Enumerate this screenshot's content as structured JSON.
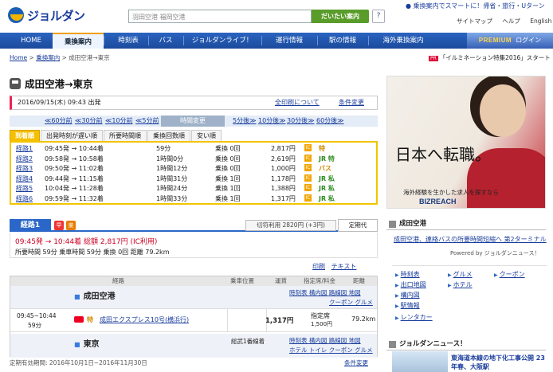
{
  "header": {
    "logo_text": "ジョルダン",
    "search_placeholder": "羽田空港 福岡空港",
    "search_button": "だいたい案内",
    "help_icon": "?",
    "promo": "● 乗換案内でスマートに！帰省・旅行・Uターン",
    "top_links": [
      "サイトマップ",
      "ヘルプ",
      "English"
    ]
  },
  "nav": {
    "items": [
      "HOME",
      "乗換案内",
      "時刻表",
      "バス",
      "ジョルダンライブ！",
      "運行情報",
      "駅の情報",
      "海外乗換案内"
    ],
    "active": "乗換案内",
    "premium": "PREMIUM",
    "login": "ログイン"
  },
  "breadcrumb": [
    "Home",
    "乗換案内",
    "成田空港→東京"
  ],
  "pr": {
    "tag": "PR",
    "text": "「イルミネーション特集2016」スタート"
  },
  "title": "成田空港→東京",
  "datetime": "2016/09/15(木) 09:43 出発",
  "link_all": "全印刷について",
  "link_change": "条件変更",
  "prev_links": [
    "≪60分前",
    "≪30分前",
    "≪10分前",
    "≪5分前"
  ],
  "time_change": "時間変更",
  "next_links": [
    "5分後≫",
    "10分後≫",
    "30分後≫",
    "60分後≫"
  ],
  "sort_tabs": [
    "到着順",
    "出発時刻が遅い順",
    "所要時間順",
    "乗換回数順",
    "安い順"
  ],
  "routes": [
    {
      "name": "経路1",
      "time": "09:45発 → 10:44着",
      "dur": "59分",
      "xfer": "乗換 0回",
      "fare": "2,817円",
      "kind": "特",
      "kc": "o"
    },
    {
      "name": "経路2",
      "time": "09:58発 → 10:58着",
      "dur": "1時間0分",
      "xfer": "乗換 0回",
      "fare": "2,619円",
      "kind": "JR 特",
      "kc": "g"
    },
    {
      "name": "経路3",
      "time": "09:50発 → 11:02着",
      "dur": "1時間12分",
      "xfer": "乗換 0回",
      "fare": "1,000円",
      "kind": "バス",
      "kc": "o"
    },
    {
      "name": "経路4",
      "time": "09:44発 → 11:15着",
      "dur": "1時間31分",
      "xfer": "乗換 1回",
      "fare": "1,178円",
      "kind": "JR 私",
      "kc": "g"
    },
    {
      "name": "経路5",
      "time": "10:04発 → 11:28着",
      "dur": "1時間24分",
      "xfer": "乗換 1回",
      "fare": "1,388円",
      "kind": "JR 私",
      "kc": "g"
    },
    {
      "name": "経路6",
      "time": "09:59発 → 11:32着",
      "dur": "1時間33分",
      "xfer": "乗換 1回",
      "fare": "1,317円",
      "kind": "JR 私",
      "kc": "g"
    }
  ],
  "route_detail": {
    "tab": "経路1",
    "badges": [
      "早",
      "楽"
    ],
    "kirifu": "切符利用 2820円 (+3円)",
    "teiki": "定期代",
    "line1": "09:45発 → 10:44着  総額 2,817円 (IC利用)",
    "line2": "所要時間 59分  乗車時間 59分  乗換 0回  距離 79.2km",
    "print": "印刷",
    "text": "テキスト",
    "headers": [
      "経路",
      "乗車位置",
      "運賃",
      "指定席/料金",
      "距離"
    ],
    "start_station": "成田空港",
    "start_links": [
      "時刻表",
      "構内図",
      "路線図",
      "地図"
    ],
    "start_links2": [
      "クーポン",
      "グルメ"
    ],
    "seg_time": "09:45~10:44",
    "seg_dur": "59分",
    "seg_train": "成田エクスプレス10号(横浜行)",
    "seg_fare": "1,317円",
    "seg_seat": "指定席",
    "seg_seat_price": "1,500円",
    "seg_dist": "79.2km",
    "end_station": "東京",
    "end_position": "総武1番線着",
    "end_links": [
      "時刻表",
      "構内図",
      "路線図",
      "地図"
    ],
    "end_links2": [
      "ホテル",
      "トイレ",
      "クーポン",
      "グルメ"
    ]
  },
  "footer": {
    "validity": "定期有効期間: 2016年10月1日~2016年11月30日",
    "change": "条件変更"
  },
  "ad": {
    "main": "日本へ転職。",
    "sub": "海外経験を生かした求人を探すなら",
    "logo": "BIZREACH"
  },
  "side_news": {
    "title": "成田空港",
    "headline": "成田空港、連絡バスの所要時間短縮へ 第2ターミナル",
    "powered": "Powered by ジョルダンニュース！",
    "links_left": [
      "時刻表",
      "出口地図",
      "構内図",
      "駅情報",
      "レンタカー"
    ],
    "links_mid": [
      "グルメ",
      "ホテル"
    ],
    "links_right": [
      "クーポン"
    ]
  },
  "news2": {
    "title": "ジョルダンニュース！",
    "headline": "東海道本線の地下化工事公開 23年春、大阪駅"
  }
}
